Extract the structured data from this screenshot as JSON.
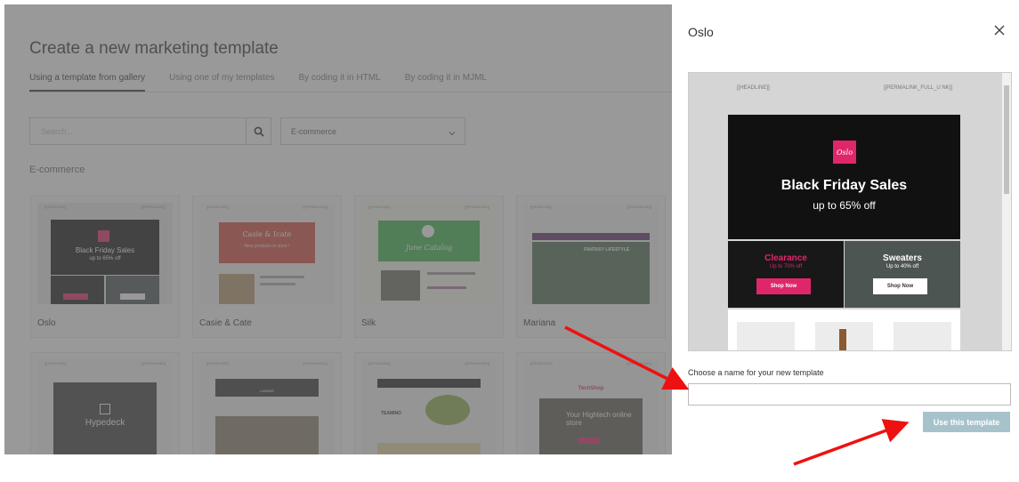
{
  "app": {
    "title": "Create a new marketing template",
    "tabs": [
      "Using a template from gallery",
      "Using one of my templates",
      "By coding it in HTML",
      "By coding it in MJML"
    ],
    "search_placeholder": "Search...",
    "category_select": "E-commerce",
    "section_title": "E-commerce",
    "templates": [
      {
        "name": "Oslo",
        "thumb_title": "Black Friday Sales",
        "thumb_sub": "up to 65% off"
      },
      {
        "name": "Casie & Cate",
        "thumb_title": "Casie & Icate",
        "thumb_sub": "New products in store !"
      },
      {
        "name": "Silk",
        "thumb_title": "June Catalog"
      },
      {
        "name": "Mariana",
        "thumb_title": "FANTASY LIFESTYLE"
      }
    ],
    "row2": [
      {
        "thumb_title": "Hypedeck"
      },
      {
        "thumb_title": "LANDRE"
      },
      {
        "thumb_title": "TEAMINO"
      },
      {
        "thumb_title": "TechShop",
        "thumb_sub": "Your Hightech online store"
      }
    ]
  },
  "modal": {
    "title": "Oslo",
    "preview": {
      "headline_token": "[[HEADLINE]]",
      "permalink_token": "[[PERMALINK_FULL_U NK]]",
      "logo": "Oslo",
      "hero_title": "Black Friday Sales",
      "hero_sub": "up to 65% off",
      "left_title": "Clearance",
      "left_sub": "Up to 70% off",
      "left_btn": "Shop Now",
      "right_title": "Sweaters",
      "right_sub": "Up to 40% off",
      "right_btn": "Shop Now"
    },
    "name_label": "Choose a name for your new template",
    "name_value": "",
    "use_button": "Use this template"
  },
  "colors": {
    "accent": "#e0266b",
    "button": "#a6c3cc",
    "arrow": "#ee1111"
  }
}
